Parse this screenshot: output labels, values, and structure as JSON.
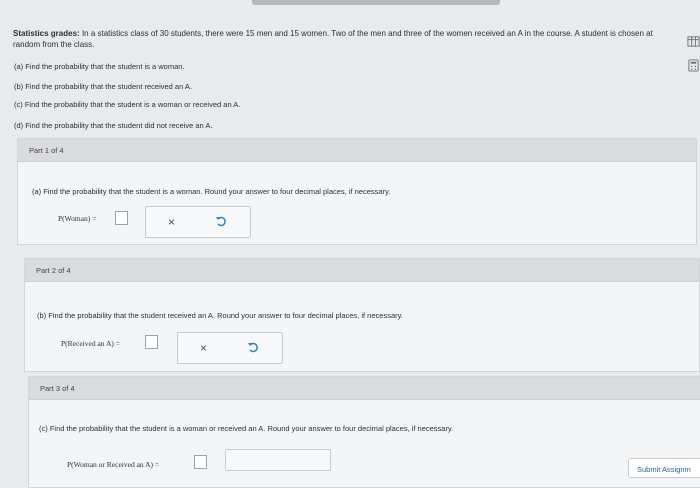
{
  "problem": {
    "lead": "Statistics grades:",
    "text": "In a statistics class of 30 students, there were 15 men and 15 women. Two of the men and three of the women received an A in the course. A student is chosen at random from the class.",
    "questions": [
      "(a) Find the probability that the student is a woman.",
      "(b) Find the probability that the student received an A.",
      "(c) Find the probability that the student is a woman or received an A.",
      "(d) Find the probability that the student did not receive an A."
    ]
  },
  "parts": [
    {
      "header": "Part 1 of 4",
      "question": "(a) Find the probability that the student is a woman. Round your answer to four decimal places, if necessary.",
      "label": "P(Woman) ="
    },
    {
      "header": "Part 2 of 4",
      "question": "(b) Find the probability that the student received an A. Round your answer to four decimal places, if necessary.",
      "label": "P(Received an A) ="
    },
    {
      "header": "Part 3 of 4",
      "question": "(c) Find the probability that the student is a woman or received an A. Round your answer to four decimal places, if necessary.",
      "label": "P(Woman or Received an A) ="
    }
  ],
  "actions": {
    "clear": "×"
  },
  "submit": {
    "label": "Submit Assignm"
  },
  "icons": {
    "side_1": "data-table-icon",
    "side_2": "calculator-icon",
    "undo": "undo-icon"
  }
}
